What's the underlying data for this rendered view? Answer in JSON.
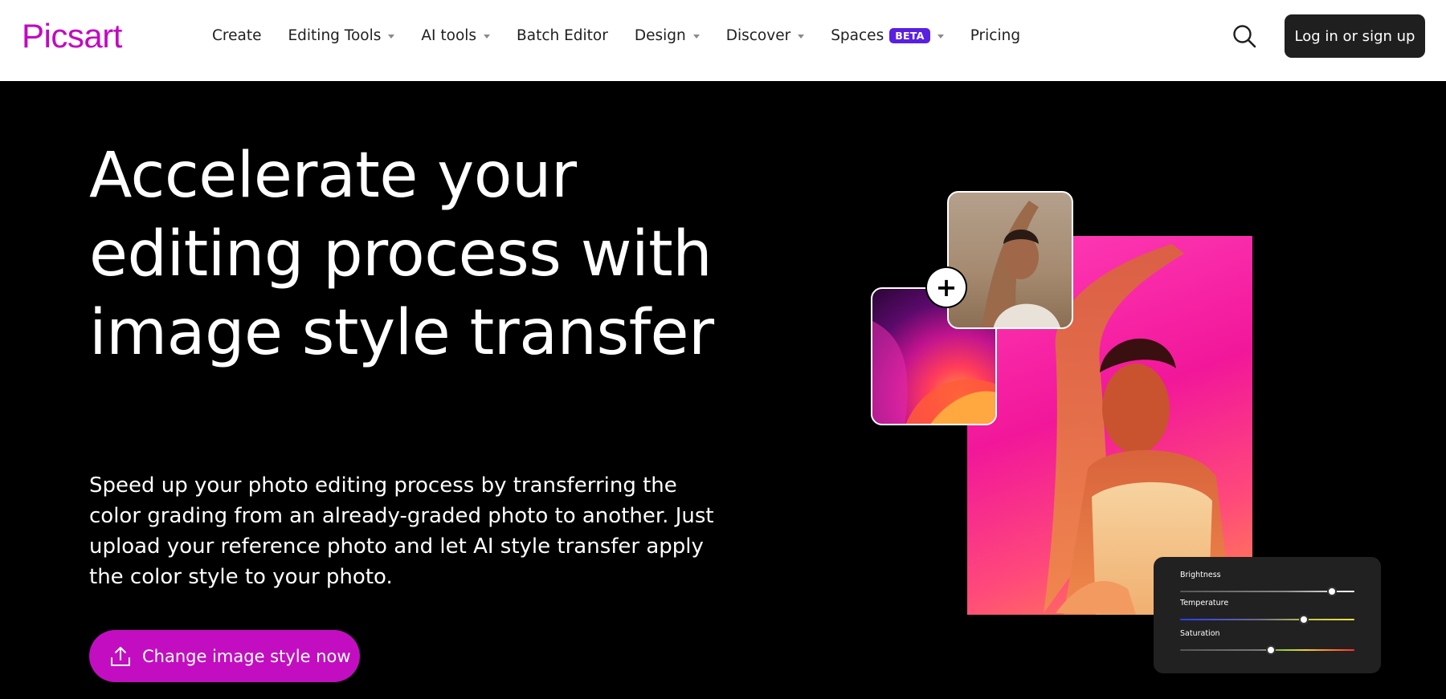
{
  "header": {
    "logo_text": "Picsart",
    "nav": [
      {
        "label": "Create",
        "has_caret": false
      },
      {
        "label": "Editing Tools",
        "has_caret": true
      },
      {
        "label": "AI tools",
        "has_caret": true
      },
      {
        "label": "Batch Editor",
        "has_caret": false
      },
      {
        "label": "Design",
        "has_caret": true
      },
      {
        "label": "Discover",
        "has_caret": true
      },
      {
        "label": "Spaces",
        "has_caret": true,
        "badge": "BETA"
      },
      {
        "label": "Pricing",
        "has_caret": false
      }
    ],
    "search_icon": "search-icon",
    "login_label": "Log in or sign up"
  },
  "hero": {
    "title": "Accelerate your editing process with image style transfer",
    "subtitle": "Speed up your photo editing process by transferring the color grading from an already-graded photo to another. Just upload your reference photo and let AI style transfer apply the color style to your photo.",
    "cta_label": "Change image style now",
    "cta_icon": "upload-icon"
  },
  "panel": {
    "sliders": [
      {
        "label": "Brightness",
        "value": 0.87
      },
      {
        "label": "Temperature",
        "value": 0.71
      },
      {
        "label": "Saturation",
        "value": 0.52
      }
    ]
  },
  "colors": {
    "brand": "#c209c1",
    "cta": "#c20ec0",
    "beta_badge": "#5a1fe0",
    "login_bg": "#1f1f1f"
  }
}
